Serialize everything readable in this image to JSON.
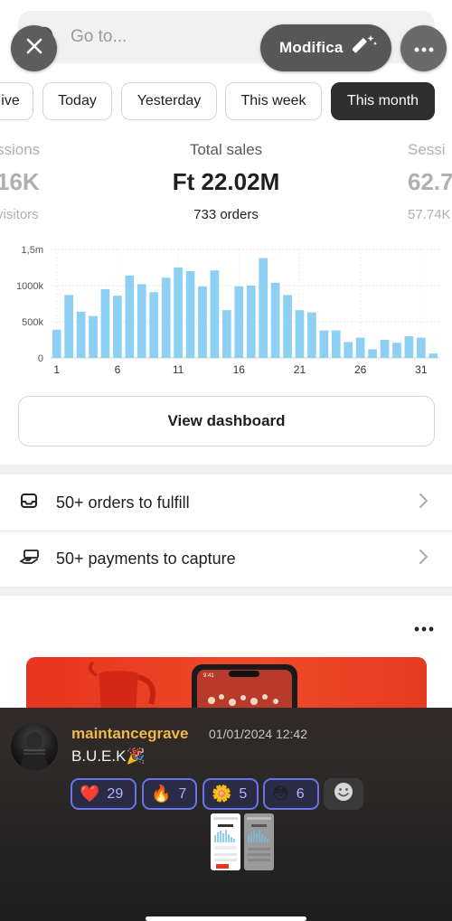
{
  "search": {
    "placeholder": "Go to..."
  },
  "toolbar": {
    "modify_label": "Modifica"
  },
  "tabs": [
    {
      "label": "ive",
      "active": false
    },
    {
      "label": "Today",
      "active": false
    },
    {
      "label": "Yesterday",
      "active": false
    },
    {
      "label": "This week",
      "active": false
    },
    {
      "label": "This month",
      "active": true
    }
  ],
  "metrics": {
    "left": {
      "title": "ssions",
      "value": "16K",
      "sub": "visitors"
    },
    "center": {
      "title": "Total sales",
      "value": "Ft 22.02M",
      "sub": "733 orders"
    },
    "right": {
      "title": "Sessi",
      "value": "62.7",
      "sub": "57.74K"
    }
  },
  "chart_data": {
    "type": "bar",
    "x_tick_labels": [
      "1",
      "6",
      "11",
      "16",
      "21",
      "26",
      "31"
    ],
    "y_tick_labels": [
      "1,5m",
      "1000k",
      "500k",
      "0"
    ],
    "ylim": [
      0,
      1500000
    ],
    "bar_color": "#8dd0f4",
    "categories": [
      1,
      2,
      3,
      4,
      5,
      6,
      7,
      8,
      9,
      10,
      11,
      12,
      13,
      14,
      15,
      16,
      17,
      18,
      19,
      20,
      21,
      22,
      23,
      24,
      25,
      26,
      27,
      28,
      29,
      30,
      31
    ],
    "values": [
      390000,
      870000,
      640000,
      580000,
      950000,
      860000,
      1140000,
      1020000,
      910000,
      1110000,
      1250000,
      1200000,
      990000,
      1210000,
      660000,
      990000,
      1000000,
      1380000,
      1040000,
      870000,
      660000,
      630000,
      380000,
      380000,
      220000,
      280000,
      120000,
      250000,
      210000,
      300000,
      280000,
      60000
    ]
  },
  "dashboard": {
    "button_label": "View dashboard"
  },
  "tasks": [
    {
      "label": "50+ orders to fulfill",
      "icon": "inbox-icon"
    },
    {
      "label": "50+ payments to capture",
      "icon": "hand-money-icon"
    }
  ],
  "chat": {
    "username": "maintancegrave",
    "timestamp": "01/01/2024 12:42",
    "message": "B.U.E.K🎉",
    "reactions": [
      {
        "emoji": "❤️",
        "count": "29"
      },
      {
        "emoji": "🔥",
        "count": "7"
      },
      {
        "emoji": "🌼",
        "count": "5"
      },
      {
        "emoji": "😳",
        "count": "6"
      }
    ]
  },
  "colors": {
    "accent_dark": "#2f2f2f",
    "bar": "#8dd0f4",
    "username": "#f0b84a",
    "reaction_border": "#6b73e8"
  }
}
